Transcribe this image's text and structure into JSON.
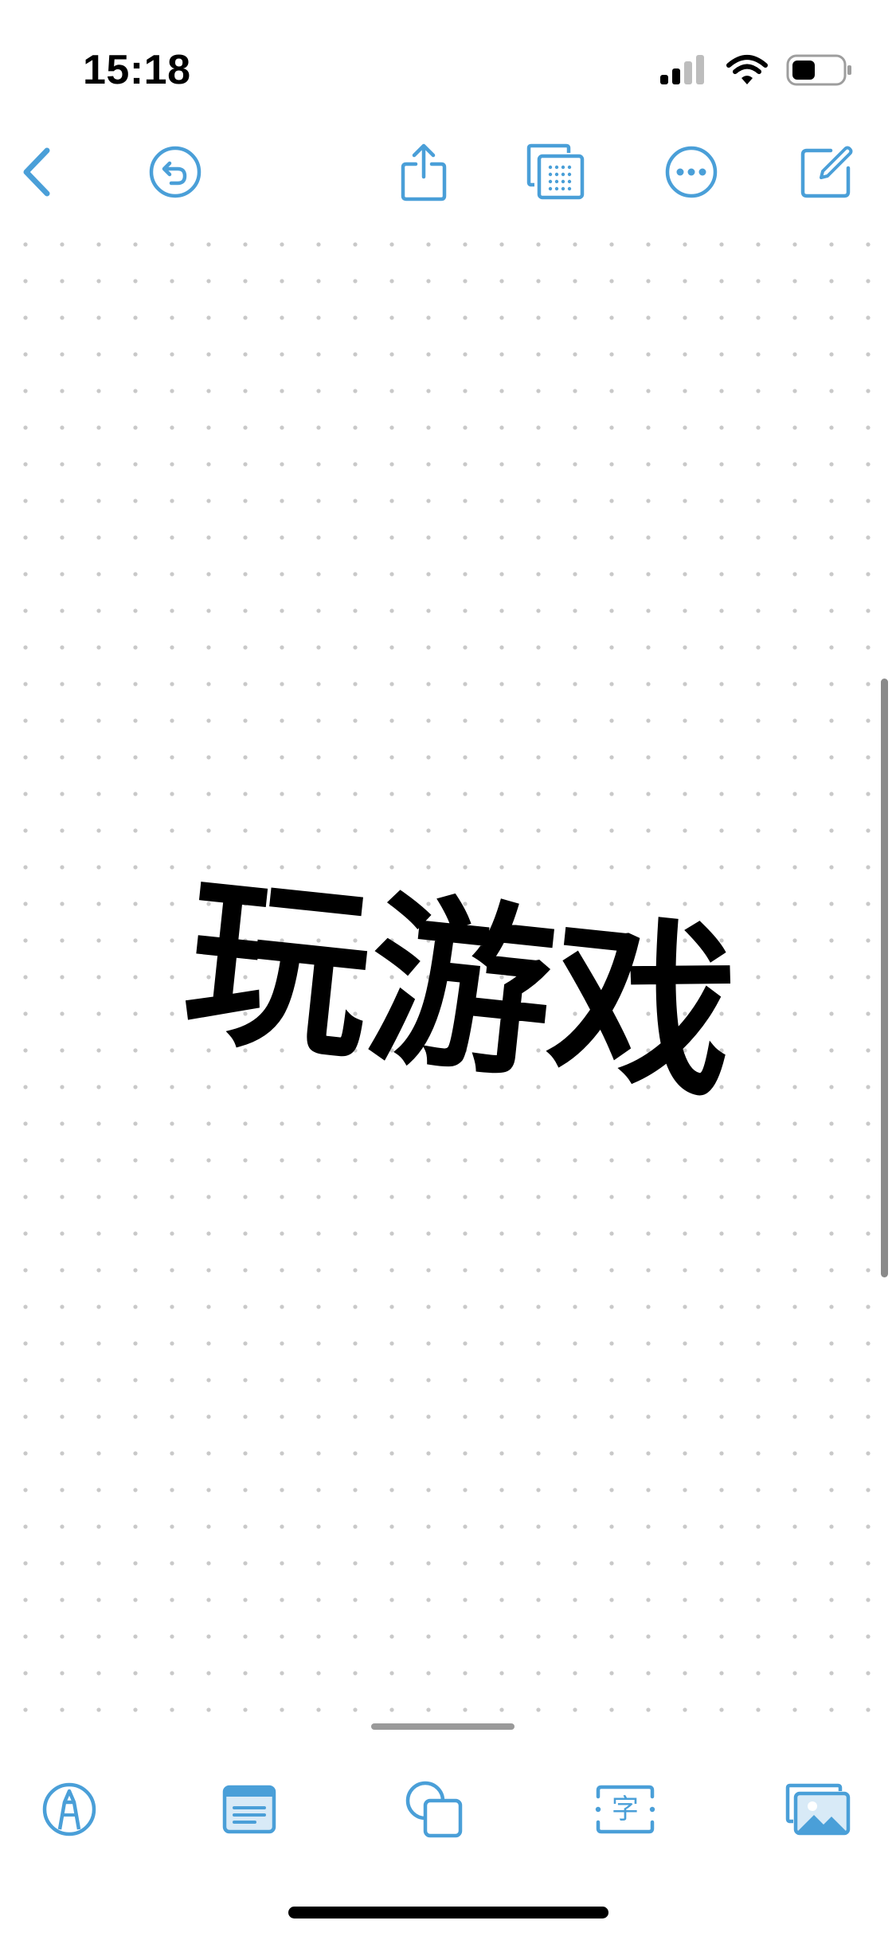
{
  "status_bar": {
    "time": "15:18"
  },
  "toolbar": {
    "back_icon": "chevron-left-icon",
    "undo_icon": "undo-icon",
    "share_icon": "share-icon",
    "view_icon": "grid-view-icon",
    "more_icon": "more-icon",
    "new_icon": "compose-icon"
  },
  "canvas": {
    "text": "玩游戏",
    "background": "dot-grid"
  },
  "bottom_toolbar": {
    "items": [
      {
        "icon": "pen-icon"
      },
      {
        "icon": "sticky-note-icon"
      },
      {
        "icon": "shapes-icon"
      },
      {
        "icon": "text-box-icon",
        "glyph": "字"
      },
      {
        "icon": "photo-icon"
      }
    ]
  },
  "colors": {
    "accent": "#4a9fd8"
  }
}
